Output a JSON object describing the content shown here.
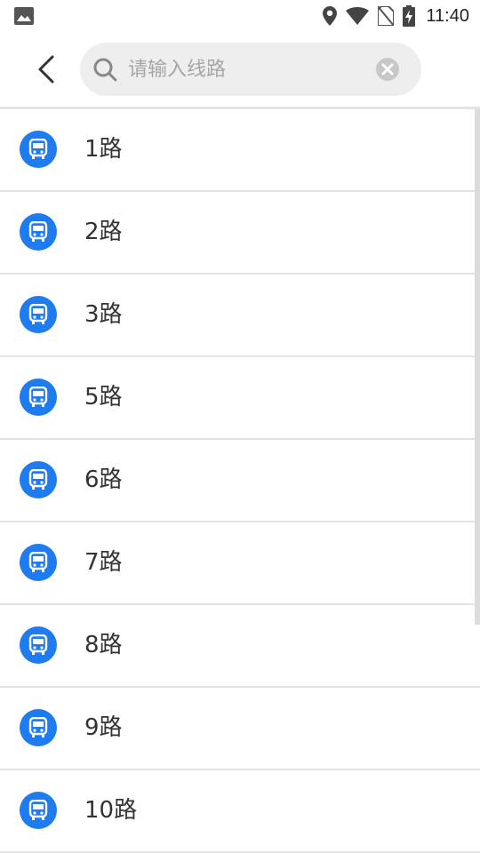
{
  "status_bar": {
    "time": "11:40",
    "left_icon": "image-icon",
    "icons": [
      "location-icon",
      "wifi-icon",
      "no-sim-icon",
      "battery-charging-icon"
    ]
  },
  "header": {
    "back_icon": "chevron-left-icon",
    "search": {
      "placeholder": "请输入线路",
      "value": "",
      "icon": "search-icon",
      "clear_icon": "clear-icon"
    }
  },
  "routes": [
    {
      "label": "1路",
      "icon": "bus-icon"
    },
    {
      "label": "2路",
      "icon": "bus-icon"
    },
    {
      "label": "3路",
      "icon": "bus-icon"
    },
    {
      "label": "5路",
      "icon": "bus-icon"
    },
    {
      "label": "6路",
      "icon": "bus-icon"
    },
    {
      "label": "7路",
      "icon": "bus-icon"
    },
    {
      "label": "8路",
      "icon": "bus-icon"
    },
    {
      "label": "9路",
      "icon": "bus-icon"
    },
    {
      "label": "10路",
      "icon": "bus-icon"
    }
  ],
  "colors": {
    "accent": "#1e7bf0",
    "text": "#333333",
    "placeholder": "#a6a6a6",
    "search_bg": "#eeeeee",
    "divider": "#e3e3e3"
  }
}
